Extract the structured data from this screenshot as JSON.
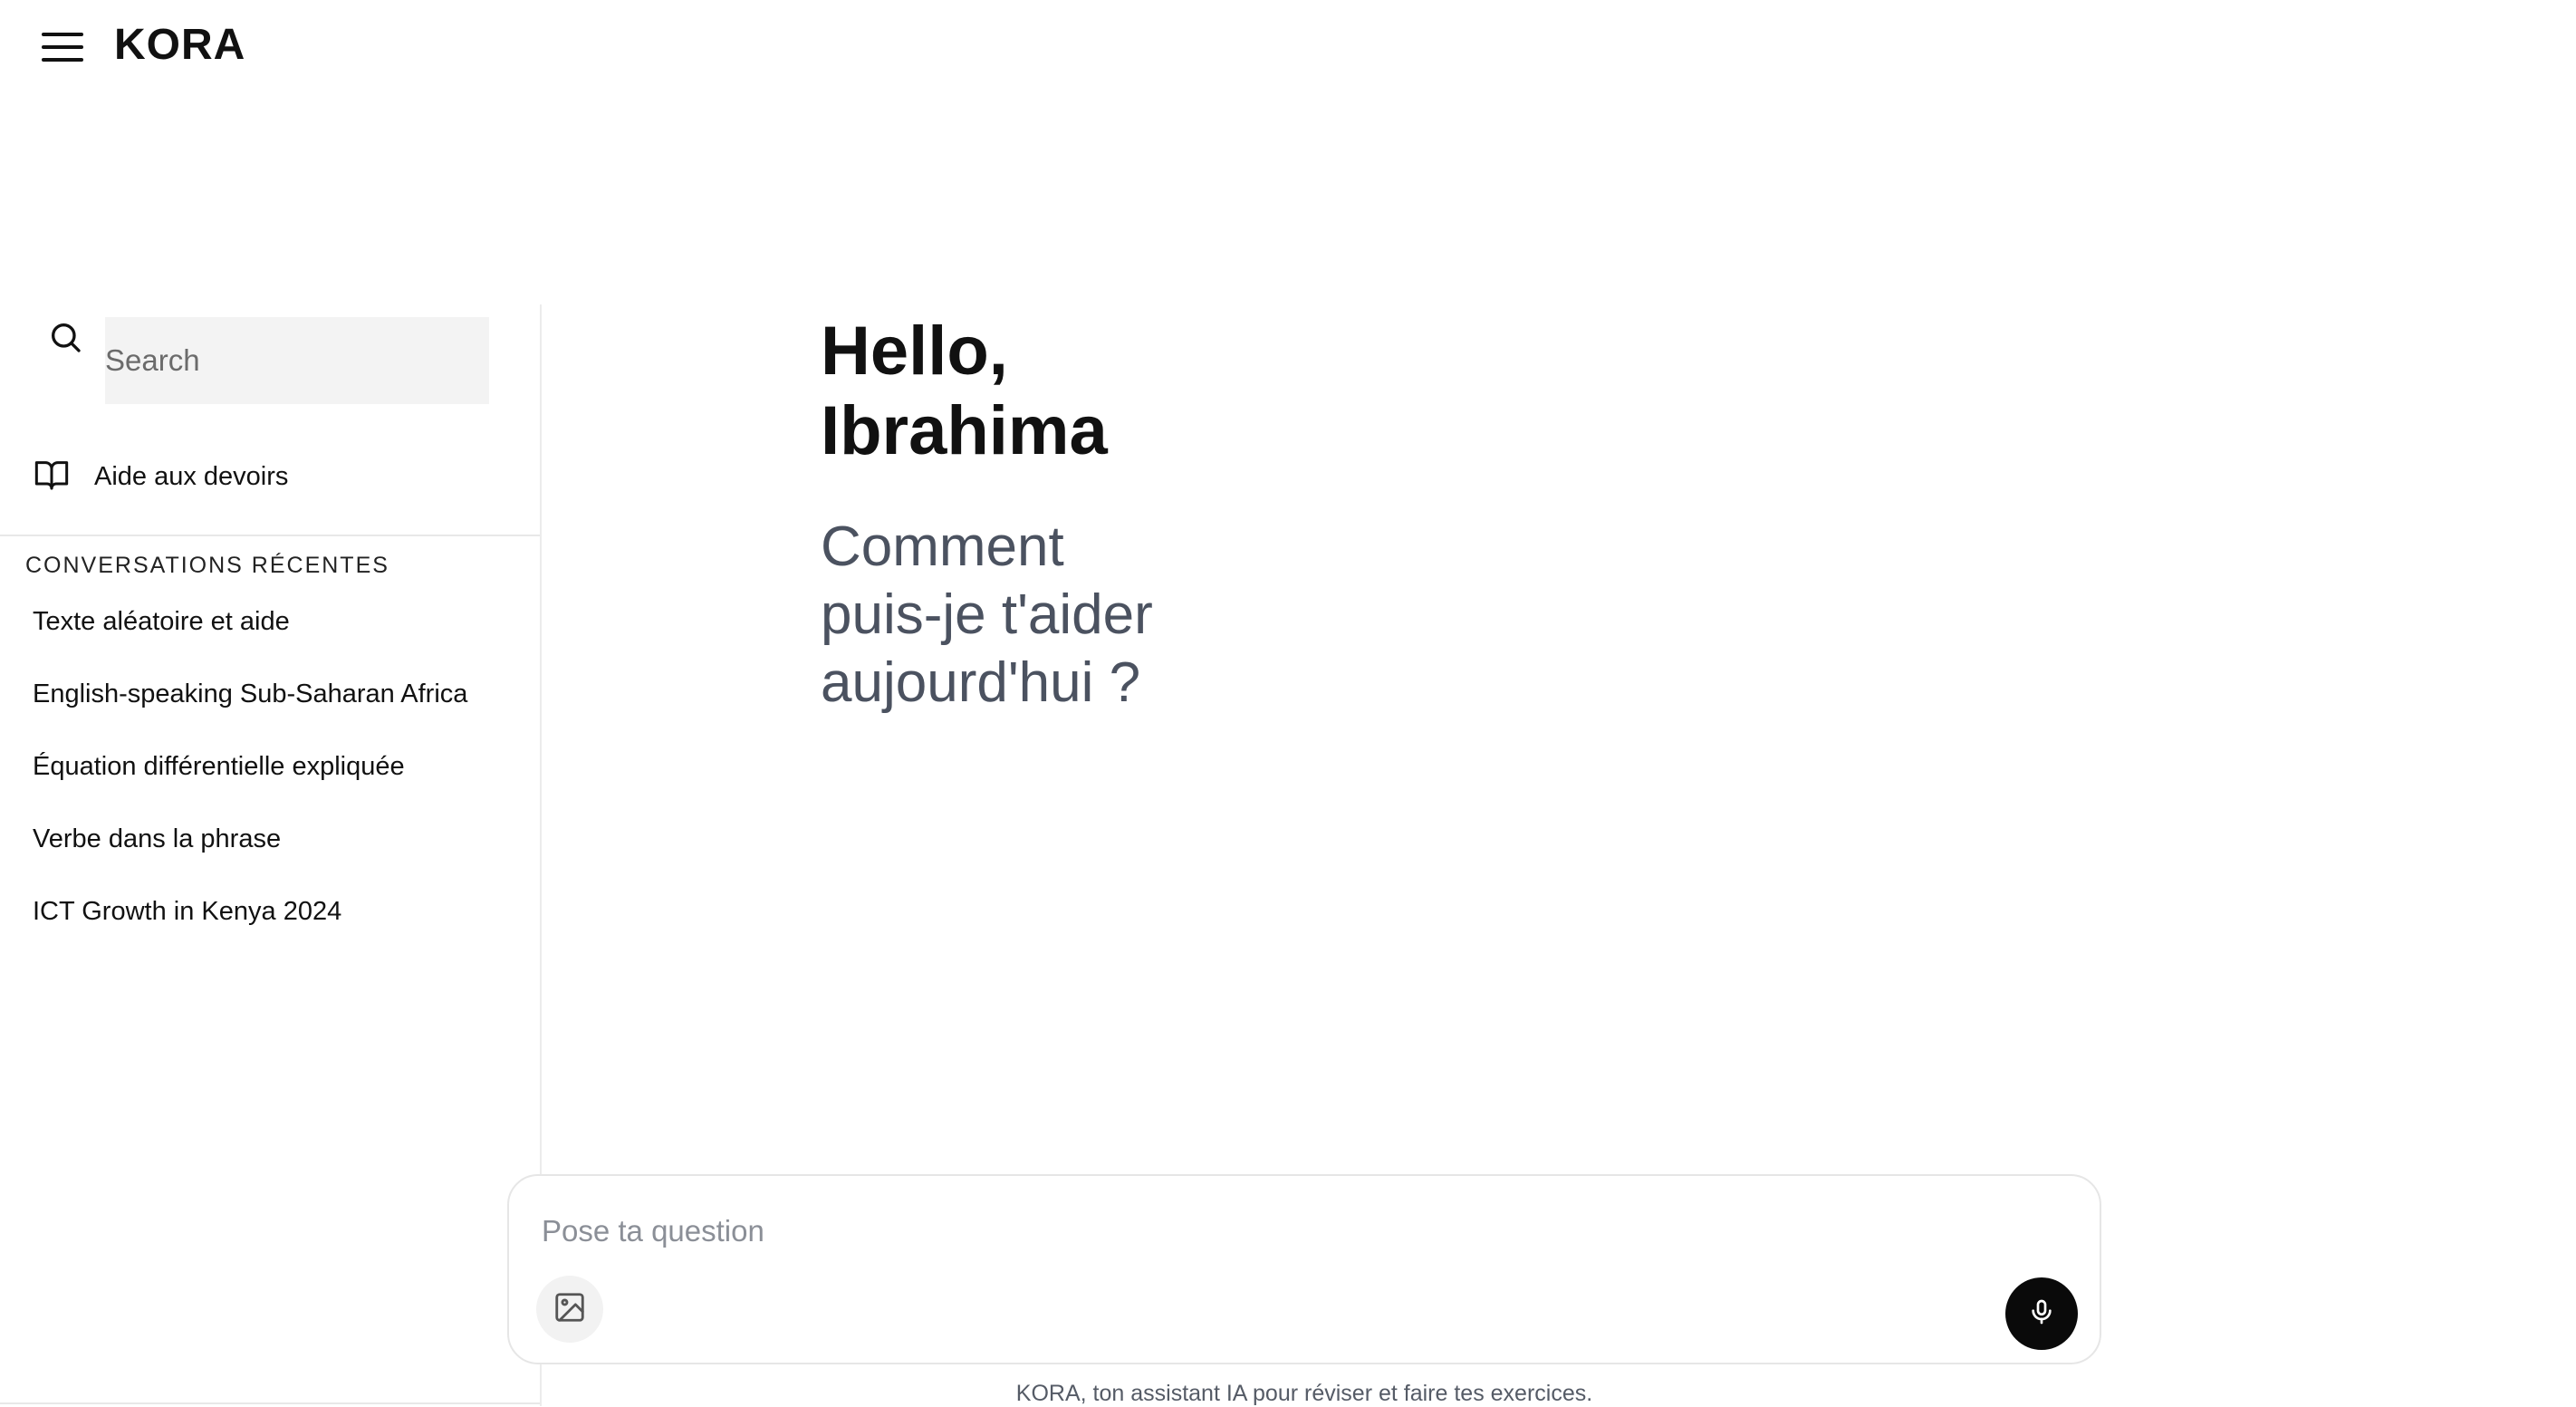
{
  "header": {
    "menu_icon": "hamburger-menu-icon",
    "brand": "KORA"
  },
  "sidebar": {
    "search": {
      "icon": "search-icon",
      "placeholder": "Search",
      "value": ""
    },
    "homework": {
      "icon": "open-book-icon",
      "label": "Aide aux devoirs"
    },
    "recent_heading": "CONVERSATIONS RÉCENTES",
    "recent": [
      "Texte aléatoire et aide",
      "English-speaking Sub-Saharan Africa",
      "Équation différentielle expliquée",
      "Verbe dans la phrase",
      "ICT Growth in Kenya 2024"
    ]
  },
  "main": {
    "greeting_line1": "Hello,",
    "greeting_line2": "Ibrahima",
    "sub_line1": "Comment",
    "sub_line2": "puis-je t'aider",
    "sub_line3": "aujourd'hui ?"
  },
  "composer": {
    "placeholder": "Pose ta question",
    "value": "",
    "image_icon": "image-upload-icon",
    "mic_icon": "microphone-icon"
  },
  "footer": {
    "note": "KORA, ton assistant IA pour réviser et faire tes exercices."
  },
  "colors": {
    "accent": "#0a0a0a",
    "muted_text": "#4b5260",
    "search_bg": "#f3f3f3"
  }
}
